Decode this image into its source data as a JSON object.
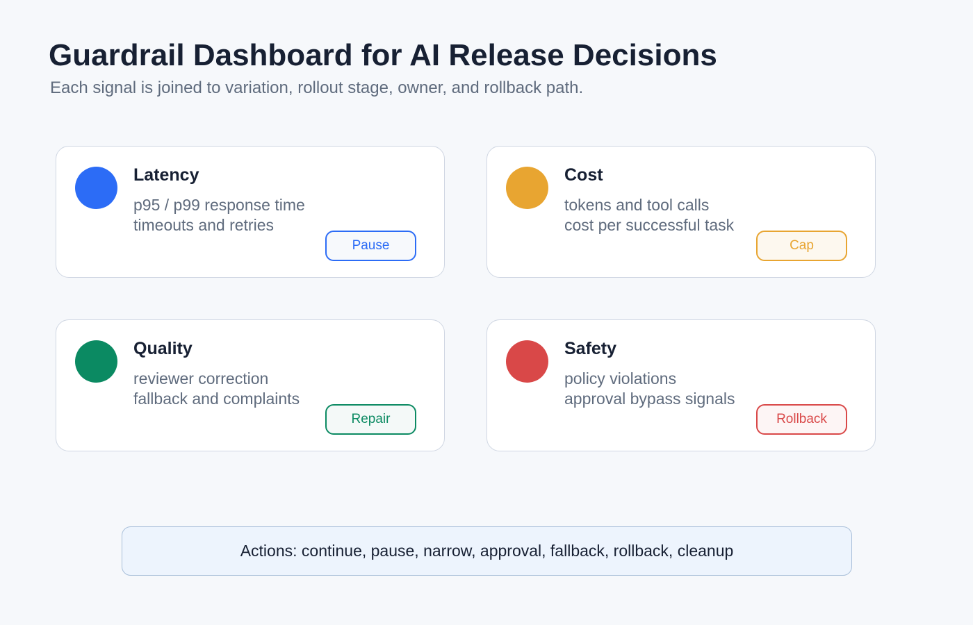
{
  "header": {
    "title": "Guardrail Dashboard for AI Release Decisions",
    "subtitle": "Each signal is joined to variation, rollout stage, owner, and rollback path."
  },
  "cards": [
    {
      "title": "Latency",
      "lines": [
        "p95 / p99 response time",
        "timeouts and retries"
      ],
      "action": "Pause",
      "color": "#2c6cf6",
      "button_bg": "#f7f9fc"
    },
    {
      "title": "Cost",
      "lines": [
        "tokens and tool calls",
        "cost per successful task"
      ],
      "action": "Cap",
      "color": "#e8a531",
      "button_bg": "#fdf8ef"
    },
    {
      "title": "Quality",
      "lines": [
        "reviewer correction",
        "fallback and complaints"
      ],
      "action": "Repair",
      "color": "#0b8a62",
      "button_bg": "#f4f9f8"
    },
    {
      "title": "Safety",
      "lines": [
        "policy violations",
        "approval bypass signals"
      ],
      "action": "Rollback",
      "color": "#d94848",
      "button_bg": "#fdf5f5"
    }
  ],
  "actions_bar": {
    "text": "Actions: continue, pause, narrow, approval, fallback, rollback, cleanup"
  }
}
